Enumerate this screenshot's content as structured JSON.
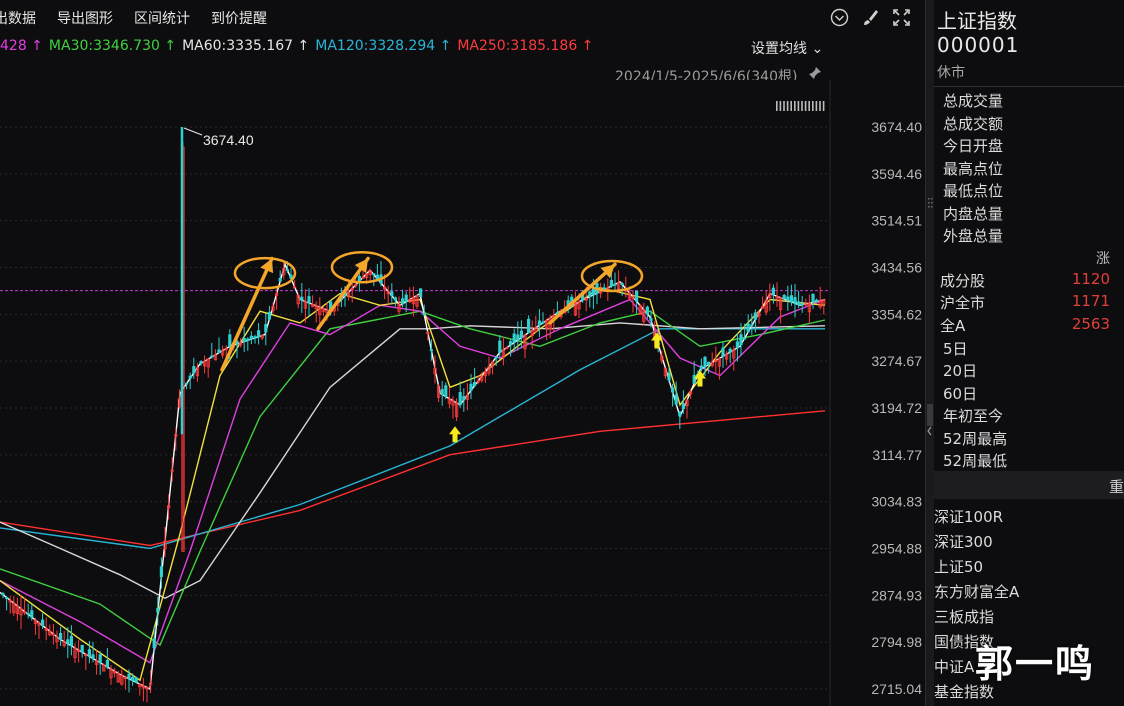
{
  "toolbar": {
    "items": [
      "出数据",
      "导出图形",
      "区间统计",
      "到价提醒"
    ],
    "icons": [
      "chevron-circle-icon",
      "brush-icon",
      "fullscreen-icon"
    ]
  },
  "ma_legend": [
    {
      "text": "428 ↑",
      "color": "#e040e0"
    },
    {
      "text": "MA30:3346.730 ↑",
      "color": "#40d040"
    },
    {
      "text": "MA60:3335.167 ↑",
      "color": "#e6e6e6"
    },
    {
      "text": "MA120:3328.294 ↑",
      "color": "#29b6d6"
    },
    {
      "text": "MA250:3185.186 ↑",
      "color": "#ff3b3b"
    }
  ],
  "ma_settings_label": "设置均线 ⌄",
  "date_range": "2024/1/5-2025/6/6(340根)",
  "pin_glyph": "📌",
  "chart_data": {
    "type": "candlestick",
    "title": "",
    "y_ticks": [
      "3674.40",
      "3594.46",
      "3514.51",
      "3434.56",
      "3354.62",
      "3274.67",
      "3194.72",
      "3114.77",
      "3034.83",
      "2954.88",
      "2874.93",
      "2794.98",
      "2715.04"
    ],
    "ylim": [
      2715.04,
      3674.4
    ],
    "high_annotation": "3674.40",
    "high_label_value": 3674.4,
    "reference_level": 3395,
    "grid": true,
    "series": [
      {
        "color": "#ff3030",
        "points": [
          [
            0,
            3000
          ],
          [
            150,
            2960
          ],
          [
            300,
            3020
          ],
          [
            450,
            3115
          ],
          [
            600,
            3155
          ],
          [
            825,
            3190
          ]
        ]
      },
      {
        "color": "#29b6d6",
        "points": [
          [
            0,
            2990
          ],
          [
            150,
            2955
          ],
          [
            300,
            3030
          ],
          [
            450,
            3130
          ],
          [
            580,
            3260
          ],
          [
            660,
            3330
          ],
          [
            825,
            3330
          ]
        ]
      },
      {
        "color": "#d8d8d8",
        "points": [
          [
            0,
            3000
          ],
          [
            60,
            2955
          ],
          [
            120,
            2910
          ],
          [
            165,
            2870
          ],
          [
            200,
            2900
          ],
          [
            260,
            3050
          ],
          [
            330,
            3230
          ],
          [
            400,
            3330
          ],
          [
            430,
            3330
          ],
          [
            470,
            3335
          ],
          [
            550,
            3330
          ],
          [
            620,
            3340
          ],
          [
            700,
            3330
          ],
          [
            825,
            3335
          ]
        ]
      },
      {
        "color": "#40d040",
        "points": [
          [
            0,
            2920
          ],
          [
            100,
            2860
          ],
          [
            160,
            2790
          ],
          [
            200,
            2950
          ],
          [
            260,
            3180
          ],
          [
            330,
            3330
          ],
          [
            420,
            3360
          ],
          [
            470,
            3330
          ],
          [
            540,
            3300
          ],
          [
            600,
            3340
          ],
          [
            650,
            3360
          ],
          [
            700,
            3300
          ],
          [
            760,
            3320
          ],
          [
            825,
            3345
          ]
        ]
      },
      {
        "color": "#e040e0",
        "points": [
          [
            0,
            2900
          ],
          [
            80,
            2830
          ],
          [
            150,
            2760
          ],
          [
            190,
            2950
          ],
          [
            240,
            3210
          ],
          [
            290,
            3340
          ],
          [
            330,
            3320
          ],
          [
            380,
            3370
          ],
          [
            420,
            3360
          ],
          [
            460,
            3300
          ],
          [
            500,
            3280
          ],
          [
            560,
            3330
          ],
          [
            630,
            3380
          ],
          [
            680,
            3280
          ],
          [
            720,
            3250
          ],
          [
            780,
            3350
          ],
          [
            825,
            3380
          ]
        ]
      },
      {
        "color": "#f2e040",
        "points": [
          [
            0,
            2900
          ],
          [
            80,
            2800
          ],
          [
            140,
            2730
          ],
          [
            180,
            2980
          ],
          [
            220,
            3250
          ],
          [
            260,
            3360
          ],
          [
            300,
            3340
          ],
          [
            340,
            3390
          ],
          [
            380,
            3370
          ],
          [
            420,
            3380
          ],
          [
            450,
            3230
          ],
          [
            480,
            3250
          ],
          [
            540,
            3330
          ],
          [
            600,
            3400
          ],
          [
            650,
            3380
          ],
          [
            680,
            3200
          ],
          [
            720,
            3290
          ],
          [
            770,
            3380
          ],
          [
            825,
            3370
          ]
        ]
      },
      {
        "color": "#ffffff",
        "points": [
          [
            0,
            2880
          ],
          [
            60,
            2800
          ],
          [
            120,
            2740
          ],
          [
            150,
            2715
          ],
          [
            180,
            3220
          ],
          [
            200,
            3270
          ],
          [
            230,
            3300
          ],
          [
            265,
            3320
          ],
          [
            285,
            3440
          ],
          [
            300,
            3380
          ],
          [
            330,
            3360
          ],
          [
            370,
            3430
          ],
          [
            400,
            3370
          ],
          [
            420,
            3390
          ],
          [
            440,
            3220
          ],
          [
            460,
            3200
          ],
          [
            500,
            3290
          ],
          [
            560,
            3360
          ],
          [
            620,
            3410
          ],
          [
            650,
            3350
          ],
          [
            680,
            3180
          ],
          [
            700,
            3260
          ],
          [
            740,
            3300
          ],
          [
            770,
            3390
          ],
          [
            800,
            3370
          ],
          [
            825,
            3380
          ]
        ]
      }
    ],
    "arrows": [
      {
        "from": [
          222,
          3260
        ],
        "to": [
          272,
          3450
        ]
      },
      {
        "from": [
          318,
          3330
        ],
        "to": [
          368,
          3450
        ]
      },
      {
        "from": [
          550,
          3340
        ],
        "to": [
          615,
          3440
        ]
      }
    ],
    "ellipses": [
      {
        "cx": 265,
        "cy": 3425
      },
      {
        "cx": 362,
        "cy": 3435
      },
      {
        "cx": 612,
        "cy": 3420
      }
    ],
    "markers": [
      {
        "x": 455,
        "y": 3150
      },
      {
        "x": 657,
        "y": 3310
      },
      {
        "x": 700,
        "y": 3245
      }
    ]
  },
  "side": {
    "title": "上证指数",
    "code": "000001",
    "status": "休市",
    "stats": [
      "总成交量",
      "总成交额",
      "今日开盘",
      "最高点位",
      "最低点位",
      "内盘总量",
      "外盘总量"
    ],
    "rise_header": "涨",
    "breadth": [
      {
        "label": "成分股",
        "value": "1120"
      },
      {
        "label": "沪全市",
        "value": "1171"
      },
      {
        "label": "全A",
        "value": "2563"
      }
    ],
    "periods": [
      "5日",
      "20日",
      "60日",
      "年初至今",
      "52周最高",
      "52周最低"
    ],
    "band_text": "重",
    "indexes": [
      "深证100R",
      "深证300",
      "上证50",
      "东方财富全A",
      "三板成指",
      "国债指数",
      "中证A",
      "基金指数"
    ]
  },
  "watermark": "郭一鸣"
}
